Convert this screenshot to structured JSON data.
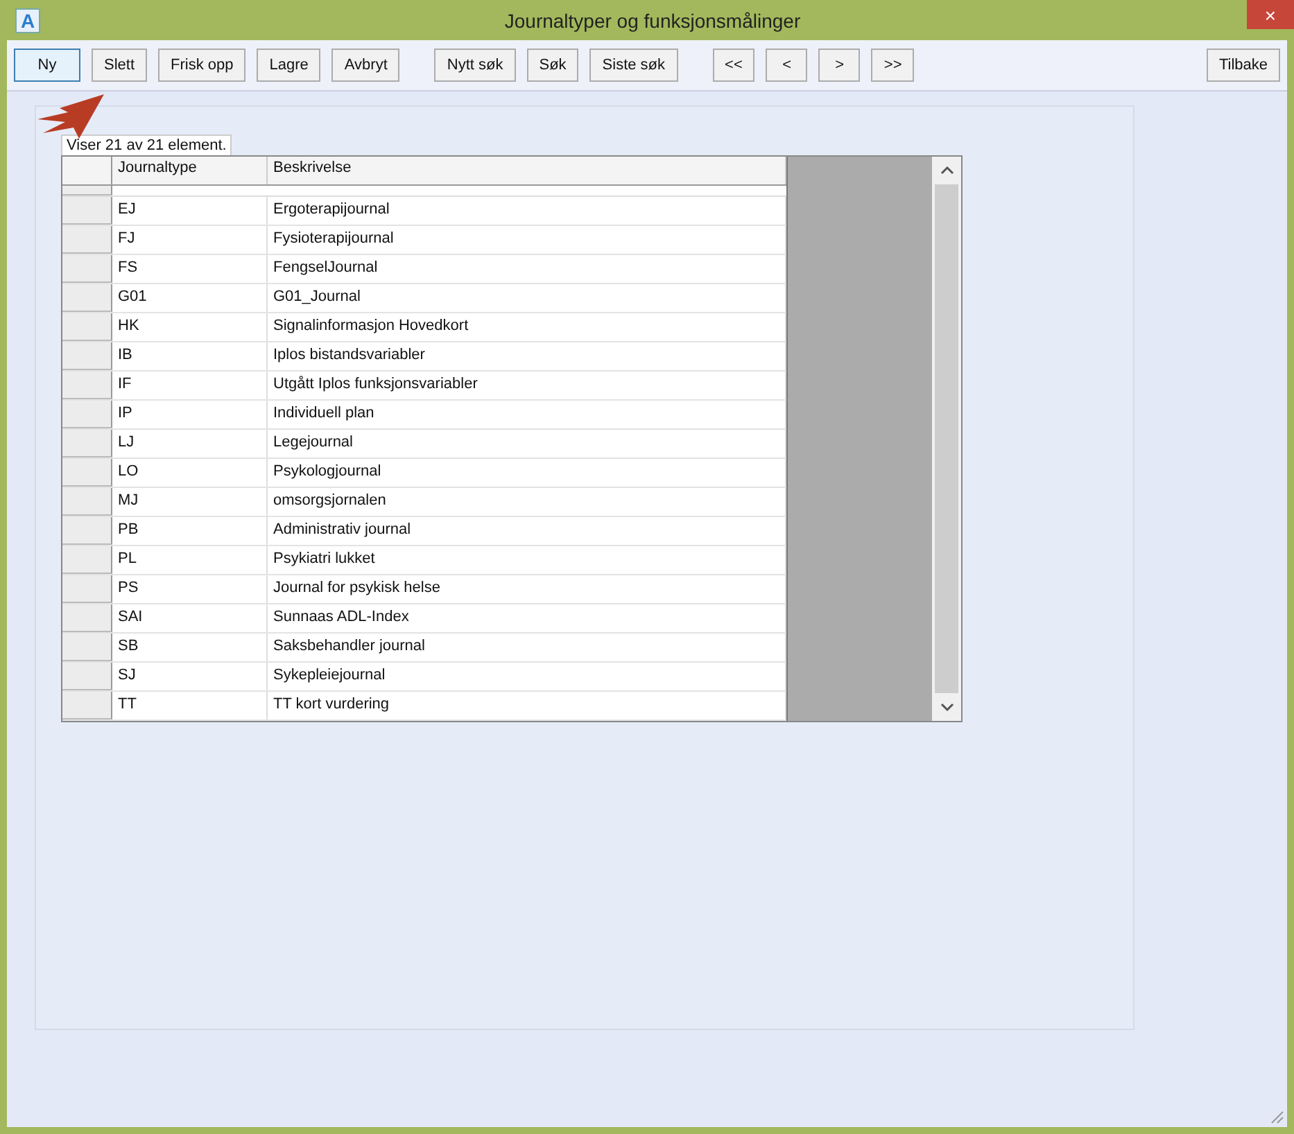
{
  "window": {
    "app_icon": "A",
    "title": "Journaltyper og funksjonsmålinger",
    "close": "×"
  },
  "toolbar": {
    "groups": [
      {
        "buttons": [
          {
            "label": "Ny",
            "default": true
          },
          {
            "label": "Slett",
            "default": false
          },
          {
            "label": "Frisk opp",
            "default": false
          },
          {
            "label": "Lagre",
            "default": false
          },
          {
            "label": "Avbryt",
            "default": false
          }
        ]
      },
      {
        "buttons": [
          {
            "label": "Nytt søk",
            "default": false
          },
          {
            "label": "Søk",
            "default": false
          },
          {
            "label": "Siste søk",
            "default": false
          }
        ]
      },
      {
        "buttons": [
          {
            "label": "<<",
            "default": false
          },
          {
            "label": "<",
            "default": false
          },
          {
            "label": ">",
            "default": false
          },
          {
            "label": ">>",
            "default": false
          }
        ]
      },
      {
        "buttons": [
          {
            "label": "Tilbake",
            "default": false
          }
        ]
      }
    ]
  },
  "status_label": "Viser 21 av 21 element.",
  "table": {
    "columns": [
      "Journaltype",
      "Beskrivelse"
    ],
    "rows": [
      [
        "EJ",
        "Ergoterapijournal"
      ],
      [
        "FJ",
        "Fysioterapijournal"
      ],
      [
        "FS",
        "FengselJournal"
      ],
      [
        "G01",
        "G01_Journal"
      ],
      [
        "HK",
        "Signalinformasjon Hovedkort"
      ],
      [
        "IB",
        "Iplos bistandsvariabler"
      ],
      [
        "IF",
        "Utgått Iplos funksjonsvariabler"
      ],
      [
        "IP",
        "Individuell plan"
      ],
      [
        "LJ",
        "Legejournal"
      ],
      [
        "LO",
        "Psykologjournal"
      ],
      [
        "MJ",
        "omsorgsjornalen"
      ],
      [
        "PB",
        "Administrativ journal"
      ],
      [
        "PL",
        "Psykiatri lukket"
      ],
      [
        "PS",
        "Journal for psykisk helse"
      ],
      [
        "SAI",
        "Sunnaas ADL-Index"
      ],
      [
        "SB",
        "Saksbehandler journal"
      ],
      [
        "SJ",
        "Sykepleiejournal"
      ],
      [
        "TT",
        "TT kort vurdering"
      ]
    ]
  }
}
